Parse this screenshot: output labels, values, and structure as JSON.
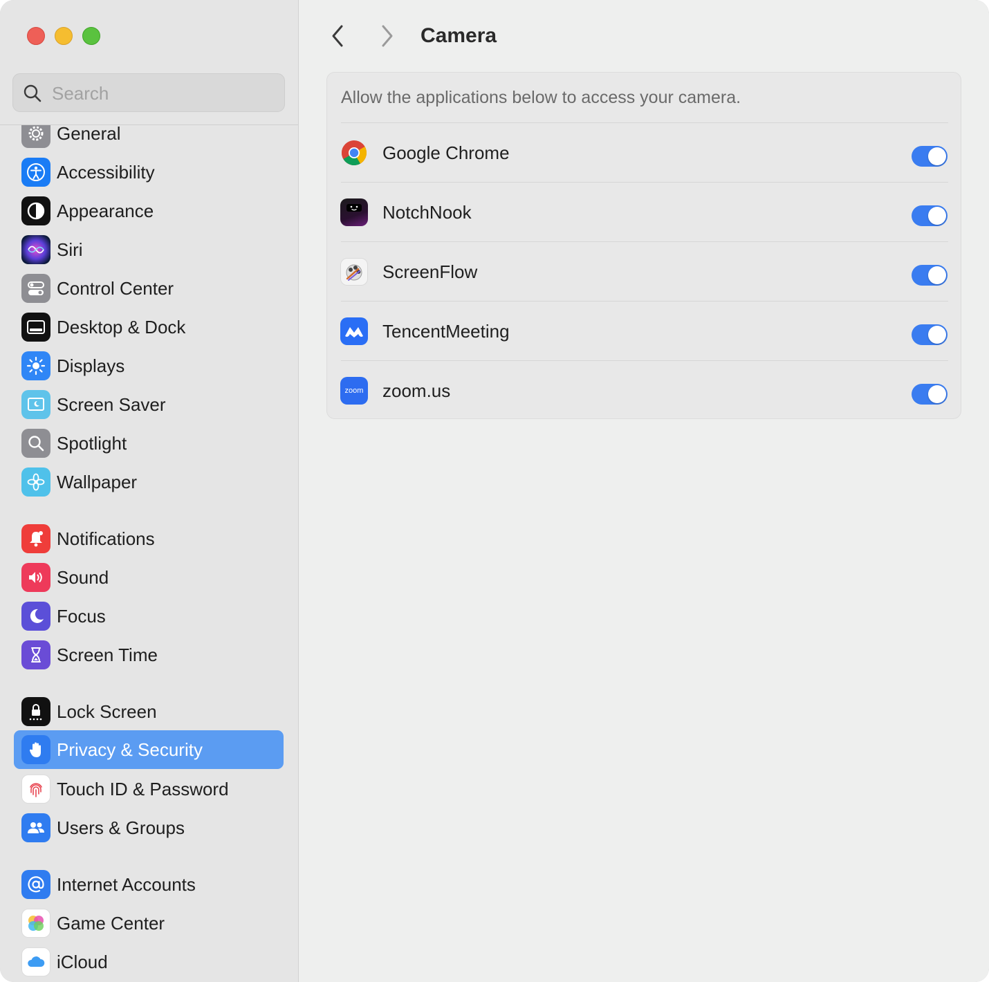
{
  "window": {
    "title": "Camera"
  },
  "search": {
    "placeholder": "Search",
    "value": ""
  },
  "nav": {
    "back_icon": "chevron-left-icon",
    "forward_icon": "chevron-right-icon"
  },
  "sidebar": {
    "items": [
      {
        "label": "General",
        "icon": "gear-icon",
        "color": "#8e8e93"
      },
      {
        "label": "Accessibility",
        "icon": "accessibility-icon",
        "color": "#1a7cf5"
      },
      {
        "label": "Appearance",
        "icon": "appearance-icon",
        "color": "#111111"
      },
      {
        "label": "Siri",
        "icon": "siri-icon",
        "color": "#7a4ad8"
      },
      {
        "label": "Control Center",
        "icon": "control-center-icon",
        "color": "#8e8e93"
      },
      {
        "label": "Desktop & Dock",
        "icon": "dock-icon",
        "color": "#111111"
      },
      {
        "label": "Displays",
        "icon": "sun-icon",
        "color": "#2f86f6"
      },
      {
        "label": "Screen Saver",
        "icon": "screen-saver-icon",
        "color": "#5fc3ea"
      },
      {
        "label": "Spotlight",
        "icon": "spotlight-icon",
        "color": "#8e8e93"
      },
      {
        "label": "Wallpaper",
        "icon": "flower-icon",
        "color": "#4fc1ea"
      },
      {
        "label": "Notifications",
        "icon": "bell-icon",
        "color": "#ef3d3a"
      },
      {
        "label": "Sound",
        "icon": "speaker-icon",
        "color": "#ee3a5a"
      },
      {
        "label": "Focus",
        "icon": "moon-icon",
        "color": "#5b4fd8"
      },
      {
        "label": "Screen Time",
        "icon": "hourglass-icon",
        "color": "#6a4cd6"
      },
      {
        "label": "Lock Screen",
        "icon": "lock-icon",
        "color": "#111111"
      },
      {
        "label": "Privacy & Security",
        "icon": "hand-icon",
        "color": "#2f7cf0",
        "selected": true
      },
      {
        "label": "Touch ID & Password",
        "icon": "fingerprint-icon",
        "color": "#ffffff"
      },
      {
        "label": "Users & Groups",
        "icon": "users-icon",
        "color": "#2f7cf0"
      },
      {
        "label": "Internet Accounts",
        "icon": "at-icon",
        "color": "#2f7cf0"
      },
      {
        "label": "Game Center",
        "icon": "game-center-icon",
        "color": "#ffffff"
      },
      {
        "label": "iCloud",
        "icon": "cloud-icon",
        "color": "#ffffff"
      }
    ]
  },
  "main": {
    "title": "Camera",
    "description": "Allow the applications below to access your camera.",
    "apps": [
      {
        "name": "Google Chrome",
        "icon": "chrome-icon",
        "enabled": true
      },
      {
        "name": "NotchNook",
        "icon": "notchnook-icon",
        "enabled": true
      },
      {
        "name": "ScreenFlow",
        "icon": "screenflow-icon",
        "enabled": true
      },
      {
        "name": "TencentMeeting",
        "icon": "tencent-meeting-icon",
        "enabled": true
      },
      {
        "name": "zoom.us",
        "icon": "zoom-icon",
        "icon_text": "zoom",
        "enabled": true
      }
    ]
  },
  "colors": {
    "accent": "#3a7cf0",
    "selection": "#5b9cf2"
  }
}
